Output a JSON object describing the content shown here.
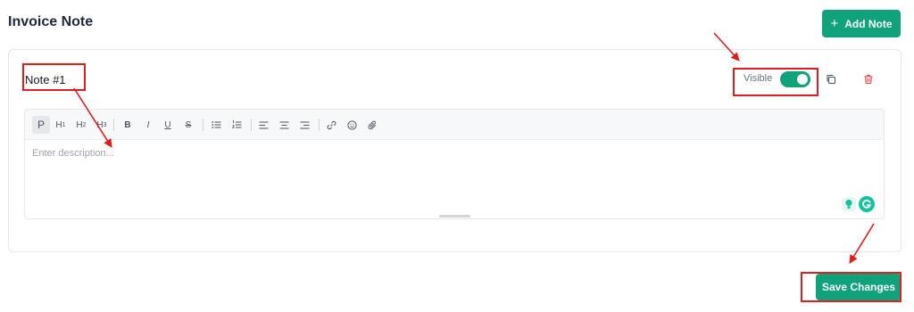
{
  "header": {
    "title": "Invoice Note",
    "add_note_label": "Add Note",
    "add_icon": "+"
  },
  "note": {
    "title": "Note #1",
    "visible_label": "Visible",
    "visible": true,
    "description_placeholder": "Enter description..."
  },
  "toolbar": {
    "paragraph": "P",
    "h1": "H",
    "h1_sub": "1",
    "h2": "H",
    "h2_sub": "2",
    "h3": "H",
    "h3_sub": "3",
    "bold": "B",
    "italic": "I",
    "underline": "U",
    "strike": "S"
  },
  "footer": {
    "save_label": "Save Changes"
  },
  "colors": {
    "brand_green": "#10a27a",
    "annotation_red": "#e11d1d",
    "trash_red": "#ef4444"
  },
  "icons": [
    "plus-icon",
    "copy-icon",
    "trash-icon",
    "bullet-list-icon",
    "ordered-list-icon",
    "align-left-icon",
    "align-center-icon",
    "align-right-icon",
    "link-icon",
    "emoji-icon",
    "attachment-icon",
    "grammarly-bulb-icon",
    "grammarly-logo-icon"
  ]
}
